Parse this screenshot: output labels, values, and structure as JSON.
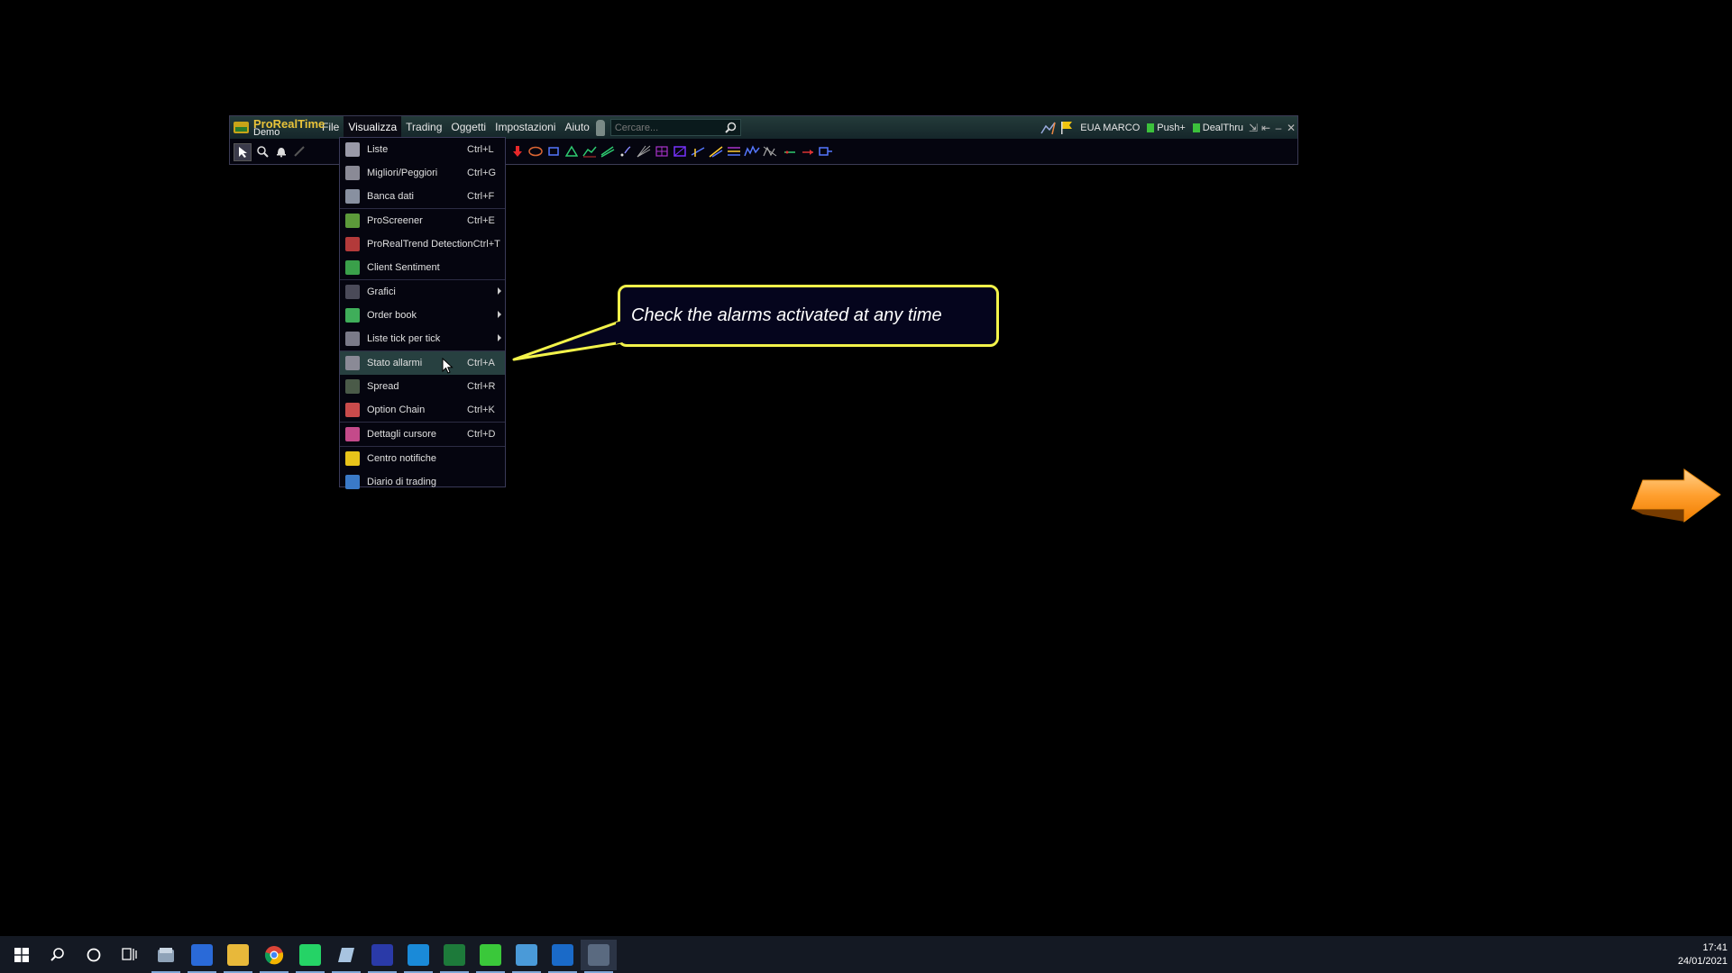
{
  "app": {
    "brand_name": "ProRealTime",
    "brand_sub": "Demo",
    "logo_colors": {
      "gold": "#c8a418",
      "green": "#2a7c2c"
    },
    "menu": [
      {
        "name": "menu-file",
        "label": "File"
      },
      {
        "name": "menu-visualizza",
        "label": "Visualizza",
        "active": true
      },
      {
        "name": "menu-trading",
        "label": "Trading"
      },
      {
        "name": "menu-oggetti",
        "label": "Oggetti"
      },
      {
        "name": "menu-impostazioni",
        "label": "Impostazioni"
      },
      {
        "name": "menu-aiuto",
        "label": "Aiuto"
      }
    ],
    "search_placeholder": "Cercare...",
    "account": "EUA MARCO",
    "push_label": "Push+",
    "dealthru_label": "DealThru"
  },
  "toolbar_icons": [
    "select-pointer-icon",
    "zoom-icon",
    "alarm-bell-icon",
    "pencil-icon",
    "move-icon",
    "copy-icon",
    "rectangle-select-icon",
    "buy-arrow-icon",
    "sell-arrow-icon",
    "ellipse-icon",
    "rectangle-icon",
    "triangle-icon",
    "trendline-icon",
    "channel-icon",
    "point-icon",
    "fibonacci-fan-icon",
    "gann-grid-icon",
    "gann-box-icon",
    "speed-lines-icon",
    "andrews-pitchfork-icon",
    "fibonacci-retracement-icon",
    "elliott-waves-icon",
    "cycles-icon",
    "horizontal-line-icon",
    "arrow-line-icon",
    "text-icon"
  ],
  "dropdown": {
    "groups": [
      [
        {
          "name": "liste",
          "label": "Liste",
          "shortcut": "Ctrl+L",
          "icon": "list-icon",
          "color": "#9a9aa8"
        },
        {
          "name": "migliori-peggiori",
          "label": "Migliori/Peggiori",
          "shortcut": "Ctrl+G",
          "icon": "ranking-icon",
          "color": "#8a8a96"
        },
        {
          "name": "banca-dati",
          "label": "Banca dati",
          "shortcut": "Ctrl+F",
          "icon": "database-icon",
          "color": "#8890a0"
        }
      ],
      [
        {
          "name": "proscreener",
          "label": "ProScreener",
          "shortcut": "Ctrl+E",
          "icon": "screener-icon",
          "color": "#5c9a3a"
        },
        {
          "name": "prorealtrend",
          "label": "ProRealTrend Detection",
          "shortcut": "Ctrl+T",
          "icon": "trend-icon",
          "color": "#b33a3a"
        },
        {
          "name": "client-sentiment",
          "label": "Client Sentiment",
          "shortcut": "",
          "icon": "sentiment-icon",
          "color": "#3aa04a"
        }
      ],
      [
        {
          "name": "grafici",
          "label": "Grafici",
          "shortcut": "",
          "icon": "chart-icon",
          "color": "#4a4a58",
          "submenu": true
        },
        {
          "name": "order-book",
          "label": "Order book",
          "shortcut": "",
          "icon": "order-book-icon",
          "color": "#3fae5a",
          "submenu": true
        },
        {
          "name": "liste-tick",
          "label": "Liste tick per tick",
          "shortcut": "",
          "icon": "tick-list-icon",
          "color": "#7a7a88",
          "submenu": true
        }
      ],
      [
        {
          "name": "stato-allarmi",
          "label": "Stato allarmi",
          "shortcut": "Ctrl+A",
          "icon": "alarm-status-icon",
          "color": "#8a8a96",
          "highlight": true
        },
        {
          "name": "spread",
          "label": "Spread",
          "shortcut": "Ctrl+R",
          "icon": "spread-icon",
          "color": "#4a5a48"
        },
        {
          "name": "option-chain",
          "label": "Option Chain",
          "shortcut": "Ctrl+K",
          "icon": "option-chain-icon",
          "color": "#c94b4b"
        }
      ],
      [
        {
          "name": "dettagli-cursore",
          "label": "Dettagli cursore",
          "shortcut": "Ctrl+D",
          "icon": "cursor-details-icon",
          "color": "#c44a8a"
        }
      ],
      [
        {
          "name": "centro-notifiche",
          "label": "Centro notifiche",
          "shortcut": "",
          "icon": "notification-flag-icon",
          "color": "#e8c41a"
        },
        {
          "name": "diario-trading",
          "label": "Diario di trading",
          "shortcut": "",
          "icon": "trading-journal-icon",
          "color": "#3a7ac8"
        }
      ]
    ]
  },
  "callout": {
    "text": "Check the alarms activated at any time",
    "border_color": "#f3f34a"
  },
  "taskbar": {
    "icons": [
      {
        "name": "windows-start-icon"
      },
      {
        "name": "search-icon"
      },
      {
        "name": "cortana-icon"
      },
      {
        "name": "task-view-icon"
      },
      {
        "name": "notepad-icon",
        "open": true
      },
      {
        "name": "s-app-icon",
        "color": "#2a6ad8",
        "open": true
      },
      {
        "name": "file-explorer-icon",
        "color": "#e8b83a",
        "open": true
      },
      {
        "name": "chrome-icon",
        "open": true
      },
      {
        "name": "whatsapp-icon",
        "color": "#25d366",
        "open": true
      },
      {
        "name": "scroll-app-icon",
        "open": true
      },
      {
        "name": "r-app-icon",
        "color": "#2a3aa8",
        "open": true
      },
      {
        "name": "skype-icon",
        "color": "#1a8ad8",
        "open": true
      },
      {
        "name": "excel-icon",
        "color": "#1d7a3a",
        "open": true
      },
      {
        "name": "fis-app-icon",
        "color": "#3ac83a",
        "open": true
      },
      {
        "name": "kite-app-icon",
        "color": "#4a9ad8",
        "open": true
      },
      {
        "name": "outlook-icon",
        "color": "#1a6ac8",
        "open": true
      },
      {
        "name": "prorealtime-demo-icon",
        "open": true,
        "active": true
      }
    ],
    "time": "17:41",
    "date": "24/01/2021"
  }
}
